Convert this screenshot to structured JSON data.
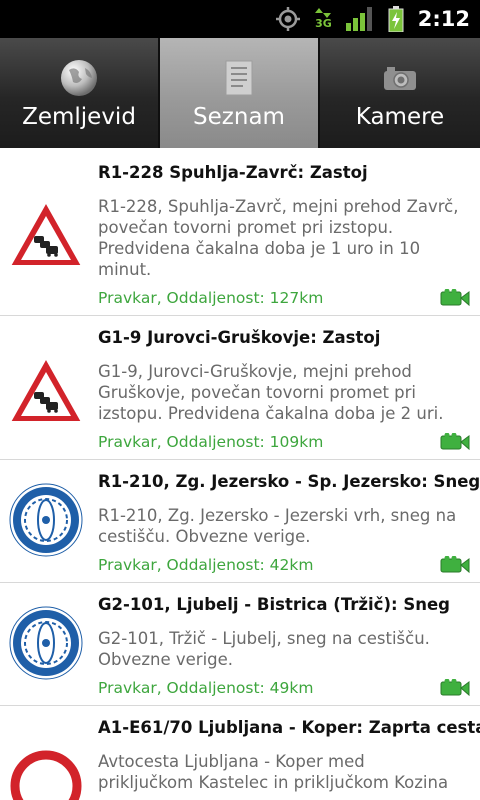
{
  "status_bar": {
    "time": "2:12",
    "network_label": "3G",
    "icons": [
      "gps-icon",
      "network-3g-icon",
      "signal-icon",
      "battery-charging-icon"
    ]
  },
  "tabs": [
    {
      "label": "Zemljevid",
      "icon": "globe-icon",
      "active": false
    },
    {
      "label": "Seznam",
      "icon": "list-icon",
      "active": true
    },
    {
      "label": "Kamere",
      "icon": "camera-icon",
      "active": false
    }
  ],
  "colors": {
    "meta_green": "#3ea63e",
    "warning_red": "#d2232a",
    "chain_blue": "#1f5fa8",
    "camera_green": "#3fb03f"
  },
  "items": [
    {
      "sign": "congestion-warning-icon",
      "title": "R1-228 Spuhlja-Zavrč: Zastoj",
      "desc": "R1-228, Spuhlja-Zavrč, mejni prehod Zavrč, povečan tovorni promet pri izstopu. Predvidena čakalna doba je 1 uro in 10 minut.",
      "meta": "Pravkar, Oddaljenost: 127km",
      "camera": true
    },
    {
      "sign": "congestion-warning-icon",
      "title": "G1-9 Jurovci-Gruškovje: Zastoj",
      "desc": "G1-9, Jurovci-Gruškovje, mejni prehod Gruškovje, povečan tovorni promet pri izstopu. Predvidena čakalna doba je 2 uri.",
      "meta": "Pravkar, Oddaljenost: 109km",
      "camera": true
    },
    {
      "sign": "snow-chains-icon",
      "title": "R1-210, Zg. Jezersko - Sp. Jezersko: Sneg",
      "desc": "R1-210, Zg. Jezersko - Jezerski vrh, sneg na cestišču. Obvezne verige.",
      "meta": "Pravkar, Oddaljenost: 42km",
      "camera": true
    },
    {
      "sign": "snow-chains-icon",
      "title": "G2-101, Ljubelj - Bistrica (Tržič): Sneg",
      "desc": "G2-101, Tržič - Ljubelj, sneg na cestišču. Obvezne verige.",
      "meta": "Pravkar, Oddaljenost: 49km",
      "camera": true
    },
    {
      "sign": "road-closed-icon",
      "title": "A1-E61/70 Ljubljana - Koper: Zaprta cesta",
      "desc": "Avtocesta Ljubljana - Koper med priključkom Kastelec in priključkom Kozina",
      "meta": "",
      "camera": false
    }
  ]
}
